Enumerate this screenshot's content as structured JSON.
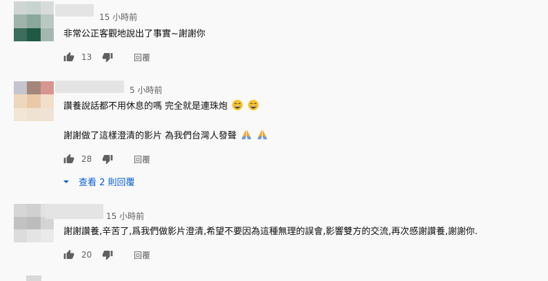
{
  "comments": [
    {
      "time": "15 小時前",
      "lines": [
        "非常公正客觀地說出了事實~謝謝你"
      ],
      "likes": "13",
      "reply_label": "回覆"
    },
    {
      "time": "5 小時前",
      "lines": [
        "讚養說話都不用休息的嗎 完全就是連珠炮",
        "謝謝做了這樣澄清的影片 為我們台灣人發聲"
      ],
      "likes": "28",
      "reply_label": "回覆",
      "view_replies": "查看 2 則回覆"
    },
    {
      "time": "15 小時前",
      "lines": [
        "謝謝讚養,辛苦了,爲我們做影片澄清,希望不要因為這種無理的誤會,影響雙方的交流,再次感謝讚養,謝謝你."
      ],
      "likes": "20",
      "reply_label": "回覆"
    }
  ],
  "icons": [
    "thumb-up-icon",
    "thumb-down-icon",
    "caret-down-icon",
    "grinning-sweat-emoji",
    "folded-hands-emoji"
  ],
  "colors": {
    "link": "#065fd4",
    "meta": "#606060",
    "text": "#0f0f0f",
    "background": "#f9f9f9"
  }
}
